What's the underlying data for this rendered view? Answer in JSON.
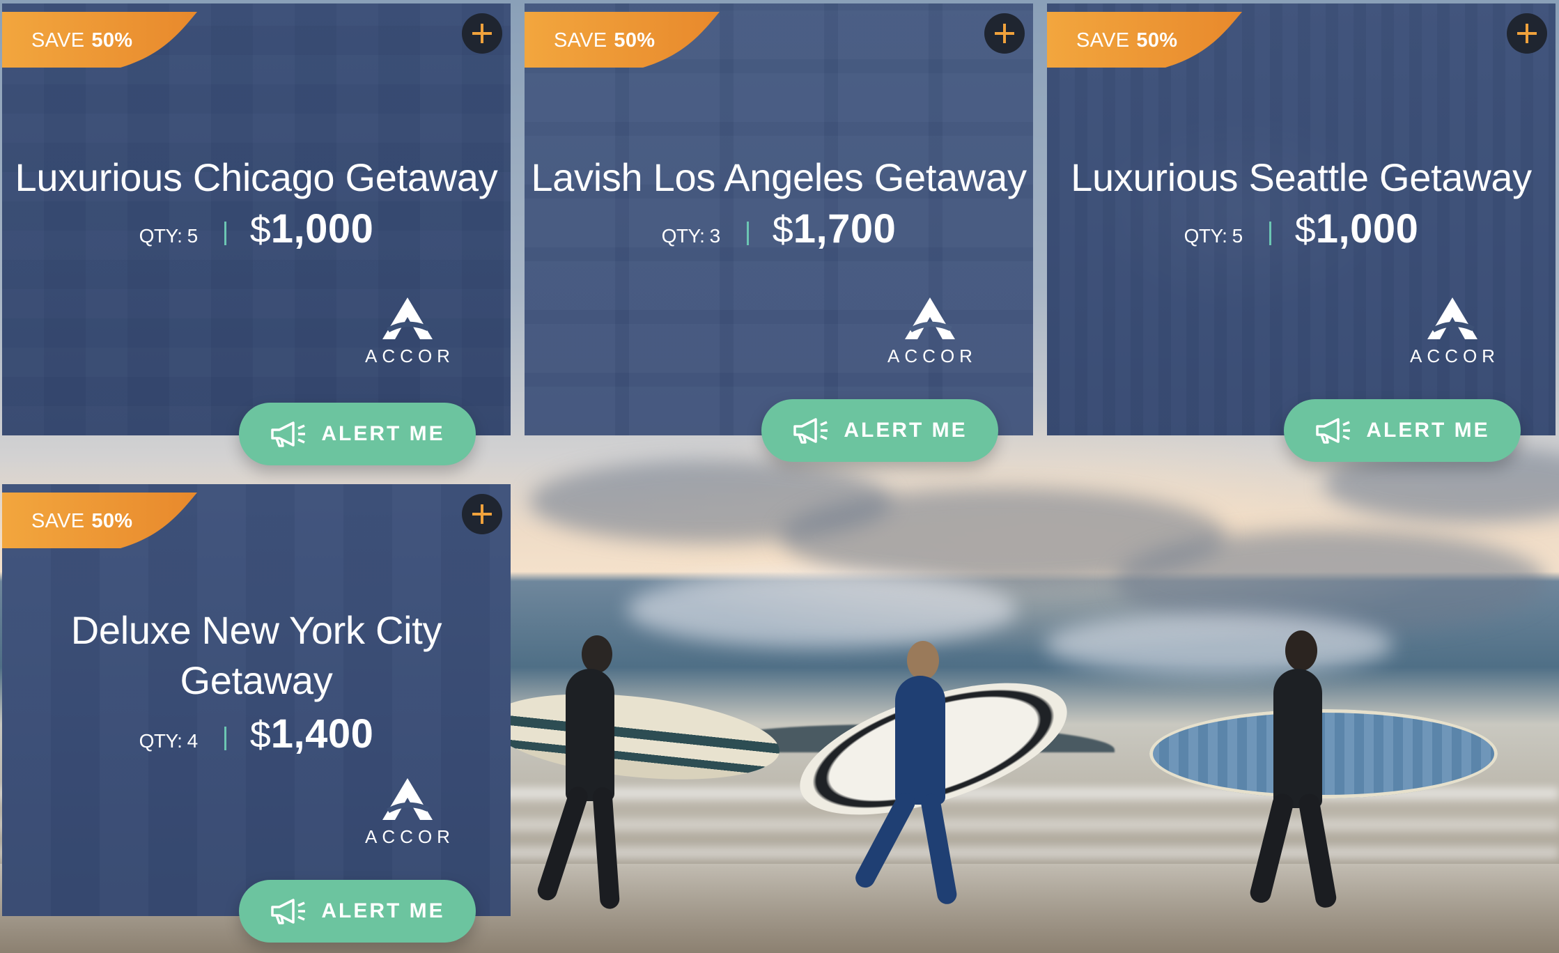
{
  "listings": [
    {
      "badge_prefix": "SAVE",
      "badge_value": "50%",
      "title": "Luxurious Chicago Getaway",
      "qty": "QTY: 5",
      "currency": "$",
      "price": "1,000",
      "brand": "ACCOR",
      "button_label": "ALERT ME"
    },
    {
      "badge_prefix": "SAVE",
      "badge_value": "50%",
      "title": "Lavish Los Angeles Getaway",
      "qty": "QTY: 3",
      "currency": "$",
      "price": "1,700",
      "brand": "ACCOR",
      "button_label": "ALERT ME"
    },
    {
      "badge_prefix": "SAVE",
      "badge_value": "50%",
      "title": "Luxurious Seattle Getaway",
      "qty": "QTY: 5",
      "currency": "$",
      "price": "1,000",
      "brand": "ACCOR",
      "button_label": "ALERT ME"
    },
    {
      "badge_prefix": "SAVE",
      "badge_value": "50%",
      "title_line1": "Deluxe New York City",
      "title_line2": "Getaway",
      "qty": "QTY: 4",
      "currency": "$",
      "price": "1,400",
      "brand": "ACCOR",
      "button_label": "ALERT ME"
    }
  ],
  "icons": {
    "add": "plus-icon",
    "alert": "megaphone-icon",
    "brand": "accor-logo-icon"
  },
  "colors": {
    "badge": "#e98a2c",
    "plus": "#f0a23c",
    "button": "#6cc49f",
    "separator": "#6cc6b3",
    "card_overlay": "#364873"
  }
}
